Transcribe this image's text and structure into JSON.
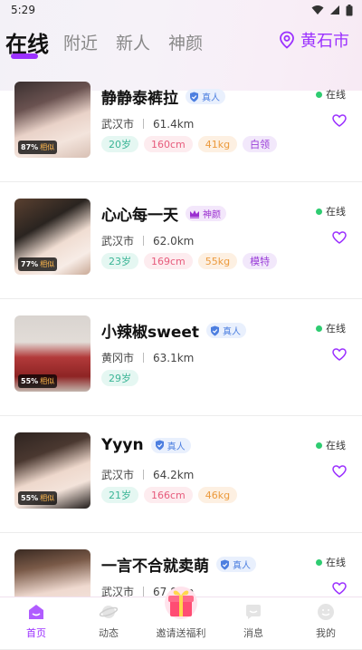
{
  "status_bar": {
    "time": "5:29"
  },
  "tabs": [
    {
      "label": "在线",
      "active": true
    },
    {
      "label": "附近",
      "active": false
    },
    {
      "label": "新人",
      "active": false
    },
    {
      "label": "神颜",
      "active": false
    }
  ],
  "city": "黄石市",
  "users": [
    {
      "name": "静静泰裤拉",
      "badge": "真人",
      "badge_type": "real",
      "match": "87%",
      "match_word": "相似",
      "city": "武汉市",
      "distance": "61.4km",
      "online": "在线",
      "tags": [
        {
          "type": "age",
          "text": "20岁"
        },
        {
          "type": "height",
          "text": "160cm"
        },
        {
          "type": "weight",
          "text": "41kg"
        },
        {
          "type": "job",
          "text": "白领"
        }
      ]
    },
    {
      "name": "心心每一天",
      "badge": "神颜",
      "badge_type": "goddess",
      "match": "77%",
      "match_word": "相似",
      "city": "武汉市",
      "distance": "62.0km",
      "online": "在线",
      "tags": [
        {
          "type": "age",
          "text": "23岁"
        },
        {
          "type": "height",
          "text": "169cm"
        },
        {
          "type": "weight",
          "text": "55kg"
        },
        {
          "type": "job",
          "text": "模特"
        }
      ]
    },
    {
      "name": "小辣椒sweet",
      "badge": "真人",
      "badge_type": "real",
      "match": "55%",
      "match_word": "相似",
      "city": "黄冈市",
      "distance": "63.1km",
      "online": "在线",
      "tags": [
        {
          "type": "age",
          "text": "29岁"
        }
      ]
    },
    {
      "name": "Yyyn",
      "badge": "真人",
      "badge_type": "real",
      "match": "55%",
      "match_word": "相似",
      "city": "武汉市",
      "distance": "64.2km",
      "online": "在线",
      "tags": [
        {
          "type": "age",
          "text": "21岁"
        },
        {
          "type": "height",
          "text": "166cm"
        },
        {
          "type": "weight",
          "text": "46kg"
        }
      ]
    },
    {
      "name": "一言不合就卖萌",
      "badge": "真人",
      "badge_type": "real",
      "match": "",
      "match_word": "",
      "city": "武汉市",
      "distance": "67.8km",
      "online": "在线",
      "tags": []
    }
  ],
  "bottom_nav": [
    {
      "label": "首页",
      "icon": "home-icon",
      "active": true
    },
    {
      "label": "动态",
      "icon": "planet-icon",
      "active": false
    },
    {
      "label": "邀请送福利",
      "icon": "gift-icon",
      "active": false
    },
    {
      "label": "消息",
      "icon": "chat-icon",
      "active": false
    },
    {
      "label": "我的",
      "icon": "profile-icon",
      "active": false
    }
  ],
  "colors": {
    "accent": "#9b30ff",
    "online": "#2ecc71"
  }
}
